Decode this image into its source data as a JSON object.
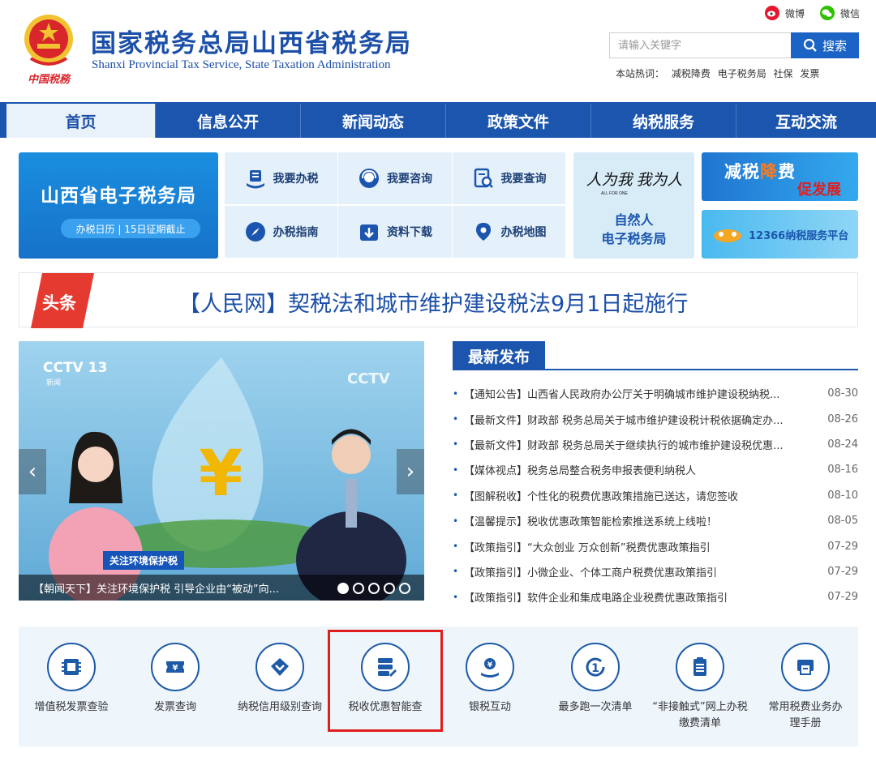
{
  "header": {
    "title": "国家税务总局山西省税务局",
    "subtitle": "Shanxi Provincial Tax Service, State Taxation Administration",
    "emblem_text": "中国税務",
    "social": [
      {
        "label": "微博",
        "icon": "weibo-icon"
      },
      {
        "label": "微信",
        "icon": "wechat-icon"
      }
    ],
    "search": {
      "placeholder": "请输入关键字",
      "button_label": "搜索"
    },
    "hot": {
      "label": "本站热词：",
      "items": [
        "减税降费",
        "电子税务局",
        "社保",
        "发票"
      ]
    }
  },
  "nav": {
    "items": [
      "首页",
      "信息公开",
      "新闻动态",
      "政策文件",
      "纳税服务",
      "互动交流"
    ],
    "active_index": 0
  },
  "services": {
    "etax": {
      "title": "山西省电子税务局",
      "pill": "办税日历 | 15日征期截止"
    },
    "grid": [
      {
        "label": "我要办税",
        "icon": "handle-tax-icon"
      },
      {
        "label": "我要咨询",
        "icon": "headset-icon"
      },
      {
        "label": "我要查询",
        "icon": "search-doc-icon"
      },
      {
        "label": "办税指南",
        "icon": "compass-icon"
      },
      {
        "label": "资料下载",
        "icon": "download-icon"
      },
      {
        "label": "办税地图",
        "icon": "map-pin-icon"
      }
    ],
    "natural": {
      "line1": "自然人",
      "line2": "电子税务局",
      "calligraphy": "人人为我 我为人人",
      "calli_small": "ALL FOR ONE"
    },
    "banner1": {
      "text_a": "减税",
      "text_b": "降",
      "text_c": "费",
      "sub": "促发展"
    },
    "banner2": {
      "text": "12366纳税服务平台"
    }
  },
  "headline": {
    "tag": "头条",
    "text": "【人民网】契税法和城市维护建设税法9月1日起施行"
  },
  "carousel": {
    "caption": "【朝闻天下】关注环境保护税 引导企业由“被动”向...",
    "tv_tag": "关注环境保护税",
    "channel": "CCTV 13",
    "channel_sub": "新闻",
    "dots": 5,
    "active_dot": 0,
    "prev": "‹",
    "next": "›"
  },
  "news": {
    "title": "最新发布",
    "items": [
      {
        "text": "【通知公告】山西省人民政府办公厅关于明确城市维护建设税纳税...",
        "date": "08-30"
      },
      {
        "text": "【最新文件】财政部 税务总局关于城市维护建设税计税依据确定办...",
        "date": "08-26"
      },
      {
        "text": "【最新文件】财政部 税务总局关于继续执行的城市维护建设税优惠...",
        "date": "08-24"
      },
      {
        "text": "【媒体视点】税务总局整合税务申报表便利纳税人",
        "date": "08-16"
      },
      {
        "text": "【图解税收】个性化的税费优惠政策措施已送达，请您签收",
        "date": "08-10"
      },
      {
        "text": "【温馨提示】税收优惠政策智能检索推送系统上线啦！",
        "date": "08-05"
      },
      {
        "text": "【政策指引】“大众创业 万众创新”税费优惠政策指引",
        "date": "07-29"
      },
      {
        "text": "【政策指引】小微企业、个体工商户税费优惠政策指引",
        "date": "07-29"
      },
      {
        "text": "【政策指引】软件企业和集成电路企业税费优惠政策指引",
        "date": "07-29"
      }
    ]
  },
  "tools": [
    {
      "label": "增值税发票查验",
      "icon": "invoice-chip-icon"
    },
    {
      "label": "发票查询",
      "icon": "ticket-icon"
    },
    {
      "label": "纳税信用级别查询",
      "icon": "credit-diamond-icon"
    },
    {
      "label": "税收优惠智能查",
      "icon": "server-stack-icon"
    },
    {
      "label": "银税互动",
      "icon": "yen-hand-icon"
    },
    {
      "label": "最多跑一次清单",
      "icon": "one-time-icon"
    },
    {
      "label": "“非接触式”网上办税缴费清单",
      "icon": "clipboard-list-icon"
    },
    {
      "label": "常用税费业务办理手册",
      "icon": "printer-manual-icon"
    }
  ],
  "colors": {
    "primary": "#1b55ae",
    "accent_red": "#e01e1e",
    "light_bg": "#e4f1fb"
  }
}
